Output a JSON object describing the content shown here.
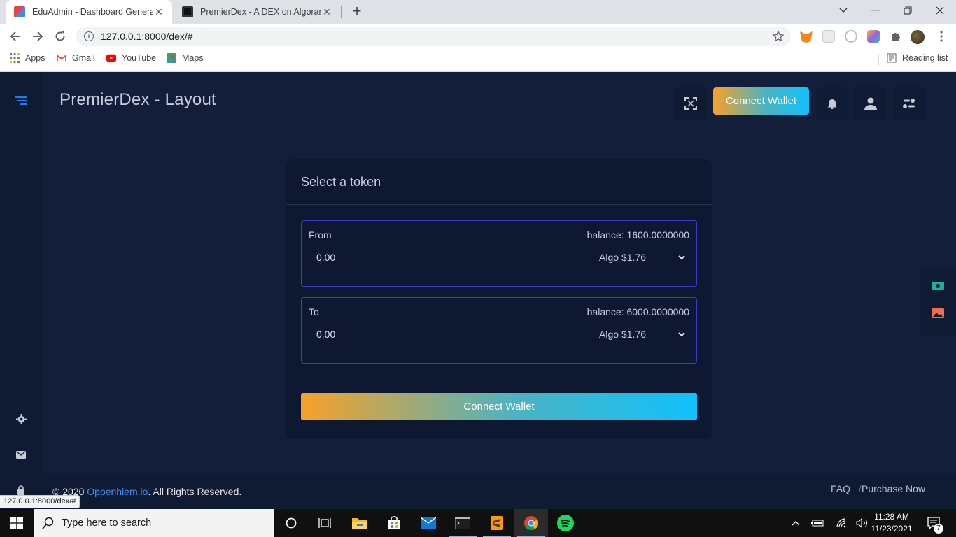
{
  "browser": {
    "tabs": [
      {
        "title": "EduAdmin - Dashboard General I",
        "active": true
      },
      {
        "title": "PremierDex - A DEX on Algorand",
        "active": false
      }
    ],
    "new_tab": "+",
    "url": "127.0.0.1:8000/dex/#",
    "bookmarks": [
      {
        "label": "Apps",
        "icon": "apps-grid-icon"
      },
      {
        "label": "Gmail",
        "icon": "gmail-icon"
      },
      {
        "label": "YouTube",
        "icon": "youtube-icon"
      },
      {
        "label": "Maps",
        "icon": "maps-icon"
      }
    ],
    "reading_list": "Reading list",
    "status_url": "127.0.0.1:8000/dex/#"
  },
  "app": {
    "title": "PremierDex - Layout",
    "header_connect": "Connect Wallet",
    "card": {
      "title": "Select a token",
      "from": {
        "label": "From",
        "balance": "balance: 1600.0000000",
        "amount": "0.00",
        "token": "Algo $1.76"
      },
      "to": {
        "label": "To",
        "balance": "balance: 6000.0000000",
        "amount": "0.00",
        "token": "Algo $1.76"
      },
      "connect": "Connect Wallet"
    },
    "footer": {
      "copyright_prefix": "© 2020 ",
      "company": "Oppenhiem.io",
      "copyright_suffix": ". All Rights Reserved.",
      "faq": "FAQ",
      "sep": "/",
      "purchase": "Purchase Now"
    },
    "colors": {
      "accent_orange": "#f7a128",
      "accent_cyan": "#11c1fb",
      "bg": "#131f3a",
      "border": "#3d3bcc"
    }
  },
  "taskbar": {
    "search_placeholder": "Type here to search",
    "time": "11:28 AM",
    "date": "11/23/2021",
    "notifications": "7"
  }
}
